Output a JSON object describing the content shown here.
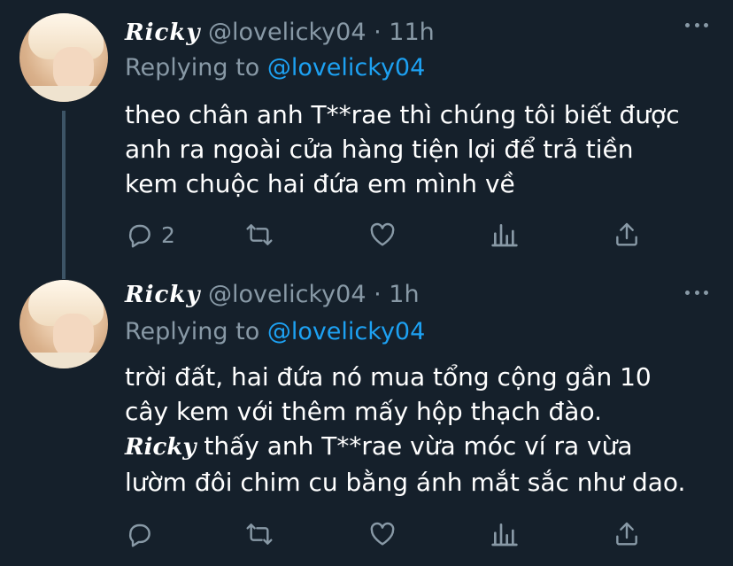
{
  "tweets": [
    {
      "display_name": "Ricky",
      "handle": "@lovelicky04",
      "separator": "·",
      "time": "11h",
      "replying_label": "Replying to",
      "replying_to": "@lovelicky04",
      "lines": [
        "theo chân anh T**rae thì chúng tôi biết được",
        "anh ra ngoài cửa hàng tiện lợi để trả tiền",
        "kem chuộc hai đứa em mình về"
      ],
      "reply_count": "2",
      "retweet_count": "",
      "like_count": ""
    },
    {
      "display_name": "Ricky",
      "handle": "@lovelicky04",
      "separator": "·",
      "time": "1h",
      "replying_label": "Replying to",
      "replying_to": "@lovelicky04",
      "lines": [
        "trời đất, hai đứa nó mua tổng cộng gần 10",
        "cây kem với thêm mấy hộp thạch đào.",
        "thấy anh T**rae vừa móc ví ra vừa",
        "lườm đôi chim cu bằng ánh mắt sắc như dao."
      ],
      "inline_name": "Ricky",
      "reply_count": "",
      "retweet_count": "",
      "like_count": ""
    }
  ],
  "colors": {
    "background": "#15202b",
    "text": "#ffffff",
    "muted": "#8899a6",
    "accent": "#1da1f2",
    "thread_line": "#3d5466"
  },
  "icons": [
    "reply-icon",
    "retweet-icon",
    "like-icon",
    "analytics-icon",
    "share-icon",
    "more-icon"
  ]
}
